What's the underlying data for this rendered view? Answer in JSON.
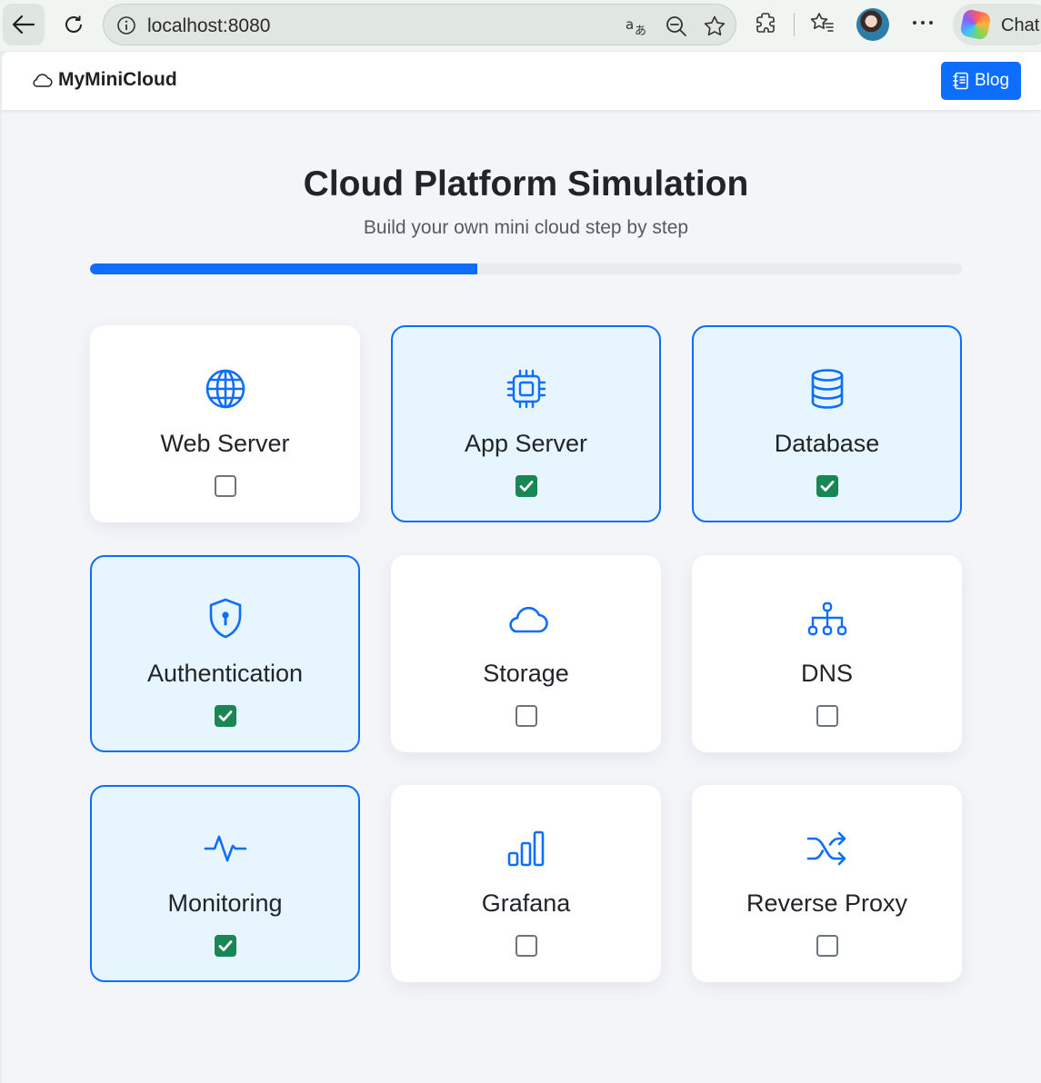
{
  "browser": {
    "url": "localhost:8080",
    "chat_label": "Chat",
    "icons": [
      "back-arrow-icon",
      "reload-icon",
      "info-icon",
      "read-aloud-icon",
      "zoom-out-icon",
      "favorite-star-icon",
      "extensions-icon",
      "favorites-icon",
      "profile-avatar",
      "more-icon",
      "copilot-icon"
    ]
  },
  "app": {
    "brand": "MyMiniCloud",
    "blog_label": "Blog",
    "accent_color": "#0d6efd",
    "checked_color": "#198754"
  },
  "header": {
    "title": "Cloud Platform Simulation",
    "subtitle": "Build your own mini cloud step by step"
  },
  "progress": {
    "fraction": 0.444
  },
  "components": [
    {
      "name": "Web Server",
      "icon": "globe-icon",
      "checked": false
    },
    {
      "name": "App Server",
      "icon": "cpu-icon",
      "checked": true
    },
    {
      "name": "Database",
      "icon": "database-icon",
      "checked": true
    },
    {
      "name": "Authentication",
      "icon": "shield-lock-icon",
      "checked": true
    },
    {
      "name": "Storage",
      "icon": "cloud-icon",
      "checked": false
    },
    {
      "name": "DNS",
      "icon": "diagram-icon",
      "checked": false
    },
    {
      "name": "Monitoring",
      "icon": "activity-icon",
      "checked": true
    },
    {
      "name": "Grafana",
      "icon": "bar-chart-icon",
      "checked": false
    },
    {
      "name": "Reverse Proxy",
      "icon": "shuffle-icon",
      "checked": false
    }
  ]
}
